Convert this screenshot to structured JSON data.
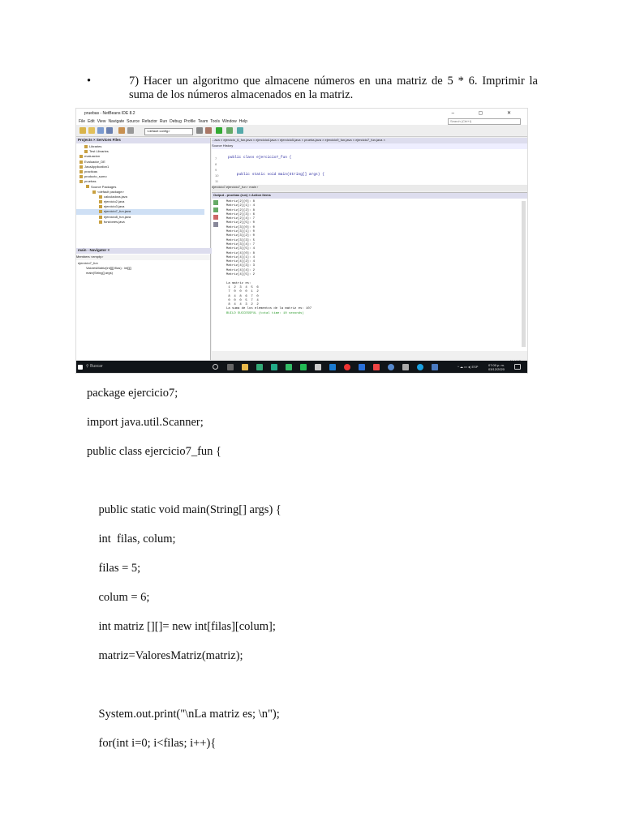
{
  "doc": {
    "bullet": "•",
    "task": "7) Hacer un algoritmo que almacene números en una matriz de 5 * 6. Imprimir la suma de los números almacenados en la matriz."
  },
  "ide": {
    "title": "pruebas - NetBeans IDE 8.2",
    "window_controls": "– ▢ ✕",
    "menu": [
      "File",
      "Edit",
      "View",
      "Navigate",
      "Source",
      "Refactor",
      "Run",
      "Debug",
      "Profile",
      "Team",
      "Tools",
      "Window",
      "Help"
    ],
    "search_placeholder": "Search (Ctrl+I)",
    "config": "<default config>",
    "projects_tabs": "Projects ×   Services   Files",
    "tree": [
      "Libraries",
      "Test Libraries",
      "evaluacion",
      "Evaluador_DE",
      "JavaApplication1",
      "practicas",
      "producto_sumo",
      "pruebas",
      "Source Packages",
      "<default package>",
      "calculadora.java",
      "ejercicio2.java",
      "ejercicio3.java",
      "ejercicio7_fun.java",
      "ejercicio8_fun.java",
      "funciones.java"
    ],
    "navigator_head": "main - Navigator ×",
    "navigator_bar": "Members   <empty>",
    "navigator_items": [
      "ejercicio7_fun",
      "ValoresMatriz(int[][] filas) : int[][]",
      "main(String[] args)"
    ],
    "editor_tabs": "...ava ×  ejercicio_6_fun.java ×  ejercicio4.java ×  ejercicio5.java ×  prueba.java ×  ejercicio9_fun.java ×  ejercicio7_fun.java ×",
    "editor_tools": "Source   History",
    "gutter": [
      "7",
      "8",
      "9",
      "10",
      "11"
    ],
    "code_lines": [
      "public class ejercicio7_fun {",
      "",
      "",
      "    public static void main(String[] args) {"
    ],
    "crumbs": "ejercicio7.ejercicio7_fun  ›  main  ›",
    "output_head": "Output - pruebas (run) ×   Action Items",
    "output_lines": [
      "Matriz[2][0]: 8",
      "Matriz[2][1]: 4",
      "Matriz[2][2]: 8",
      "Matriz[2][3]: 6",
      "Matriz[2][4]: 7",
      "Matriz[2][5]: 0",
      "Matriz[3][0]: 0",
      "Matriz[3][1]: 0",
      "Matriz[3][2]: 0",
      "Matriz[3][3]: 5",
      "Matriz[3][4]: 7",
      "Matriz[3][5]: 4",
      "Matriz[4][0]: 8",
      "Matriz[4][1]: 4",
      "Matriz[4][2]: 4",
      "Matriz[4][3]: 3",
      "Matriz[4][4]: 2",
      "Matriz[4][5]: 2",
      "",
      "La matriz es:",
      " 1  2  3  4  5  6",
      " 7  0  0  0  1  2",
      " 8  4  8  6  7  0",
      " 0  0  0  5  7  4",
      " 8  4  4  3  2  2",
      "La suma de los elementos de la matriz es: 107"
    ],
    "output_build": "BUILD SUCCESSFUL (total time: 10 seconds)",
    "status": "11:4   INS",
    "taskbar_search": "Buscar",
    "clock_time": "07:00 p. m.",
    "clock_date": "03/12/2020",
    "lang": "ESP"
  },
  "code": {
    "l1": "package ejercicio7;",
    "l2": "import java.util.Scanner;",
    "l3": "public class ejercicio7_fun {",
    "l4": "    public static void main(String[] args) {",
    "l5": "    int  filas, colum;",
    "l6": "    filas = 5;",
    "l7": "    colum = 6;",
    "l8": "    int matriz [][]= new int[filas][colum];",
    "l9": "    matriz=ValoresMatriz(matriz);",
    "l10": "    System.out.print(\"\\nLa matriz es; \\n\");",
    "l11": "    for(int i=0; i<filas; i++){"
  }
}
